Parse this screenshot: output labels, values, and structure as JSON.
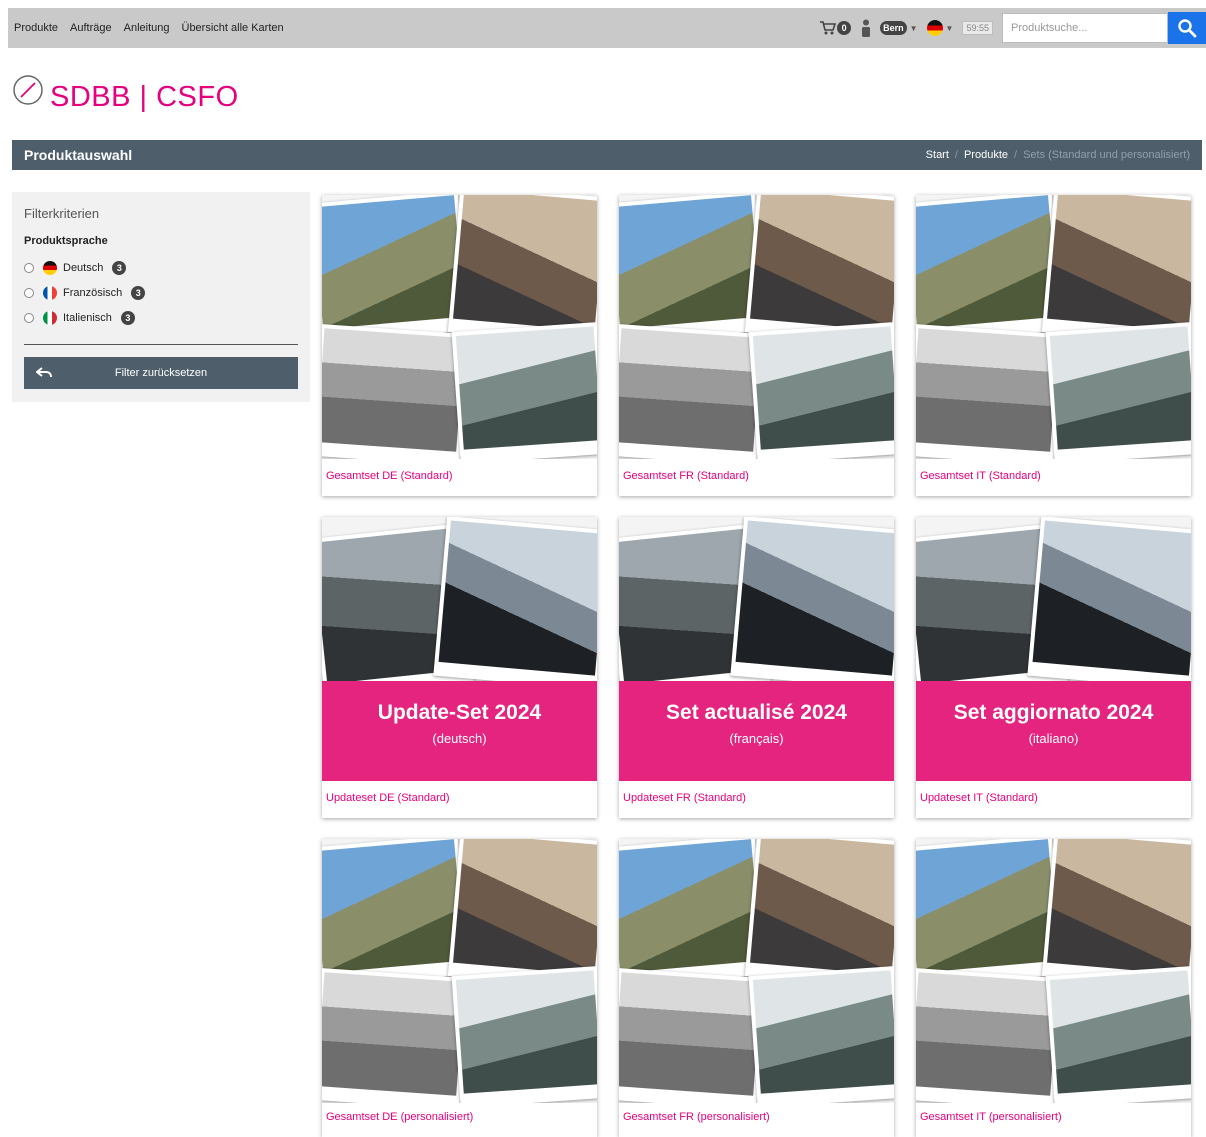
{
  "topnav": {
    "items": [
      "Produkte",
      "Aufträge",
      "Anleitung",
      "Übersicht alle Karten"
    ]
  },
  "header_right": {
    "cart_count": "0",
    "user_badge": "Bern",
    "time": "59:55",
    "search_placeholder": "Produktsuche..."
  },
  "logo": {
    "text": "SDBB | CSFO"
  },
  "titlebar": {
    "title": "Produktauswahl",
    "breadcrumb": [
      "Start",
      "Produkte",
      "Sets (Standard und personalisiert)"
    ]
  },
  "filter": {
    "title": "Filterkriterien",
    "group_label": "Produktsprache",
    "options": [
      {
        "label": "Deutsch",
        "count": "3",
        "flag": "de"
      },
      {
        "label": "Französisch",
        "count": "3",
        "flag": "fr"
      },
      {
        "label": "Italienisch",
        "count": "3",
        "flag": "it"
      }
    ],
    "reset_label": "Filter zurücksetzen"
  },
  "products": [
    {
      "caption": "Gesamtset DE (Standard)",
      "kind": "collage"
    },
    {
      "caption": "Gesamtset FR (Standard)",
      "kind": "collage"
    },
    {
      "caption": "Gesamtset IT (Standard)",
      "kind": "collage"
    },
    {
      "caption": "Updateset DE (Standard)",
      "kind": "update",
      "banner_title": "Update-Set 2024",
      "banner_sub": "(deutsch)"
    },
    {
      "caption": "Updateset FR (Standard)",
      "kind": "update",
      "banner_title": "Set actualisé 2024",
      "banner_sub": "(français)"
    },
    {
      "caption": "Updateset IT (Standard)",
      "kind": "update",
      "banner_title": "Set aggiornato 2024",
      "banner_sub": "(italiano)"
    },
    {
      "caption": "Gesamtset DE (personalisiert)",
      "kind": "collage"
    },
    {
      "caption": "Gesamtset FR (personalisiert)",
      "kind": "collage"
    },
    {
      "caption": "Gesamtset IT (personalisiert)",
      "kind": "collage"
    }
  ],
  "colors": {
    "brand_pink": "#e6007e",
    "bar_slate": "#4e5f6b",
    "search_blue": "#1a73e8",
    "banner_pink": "#e4247f"
  }
}
